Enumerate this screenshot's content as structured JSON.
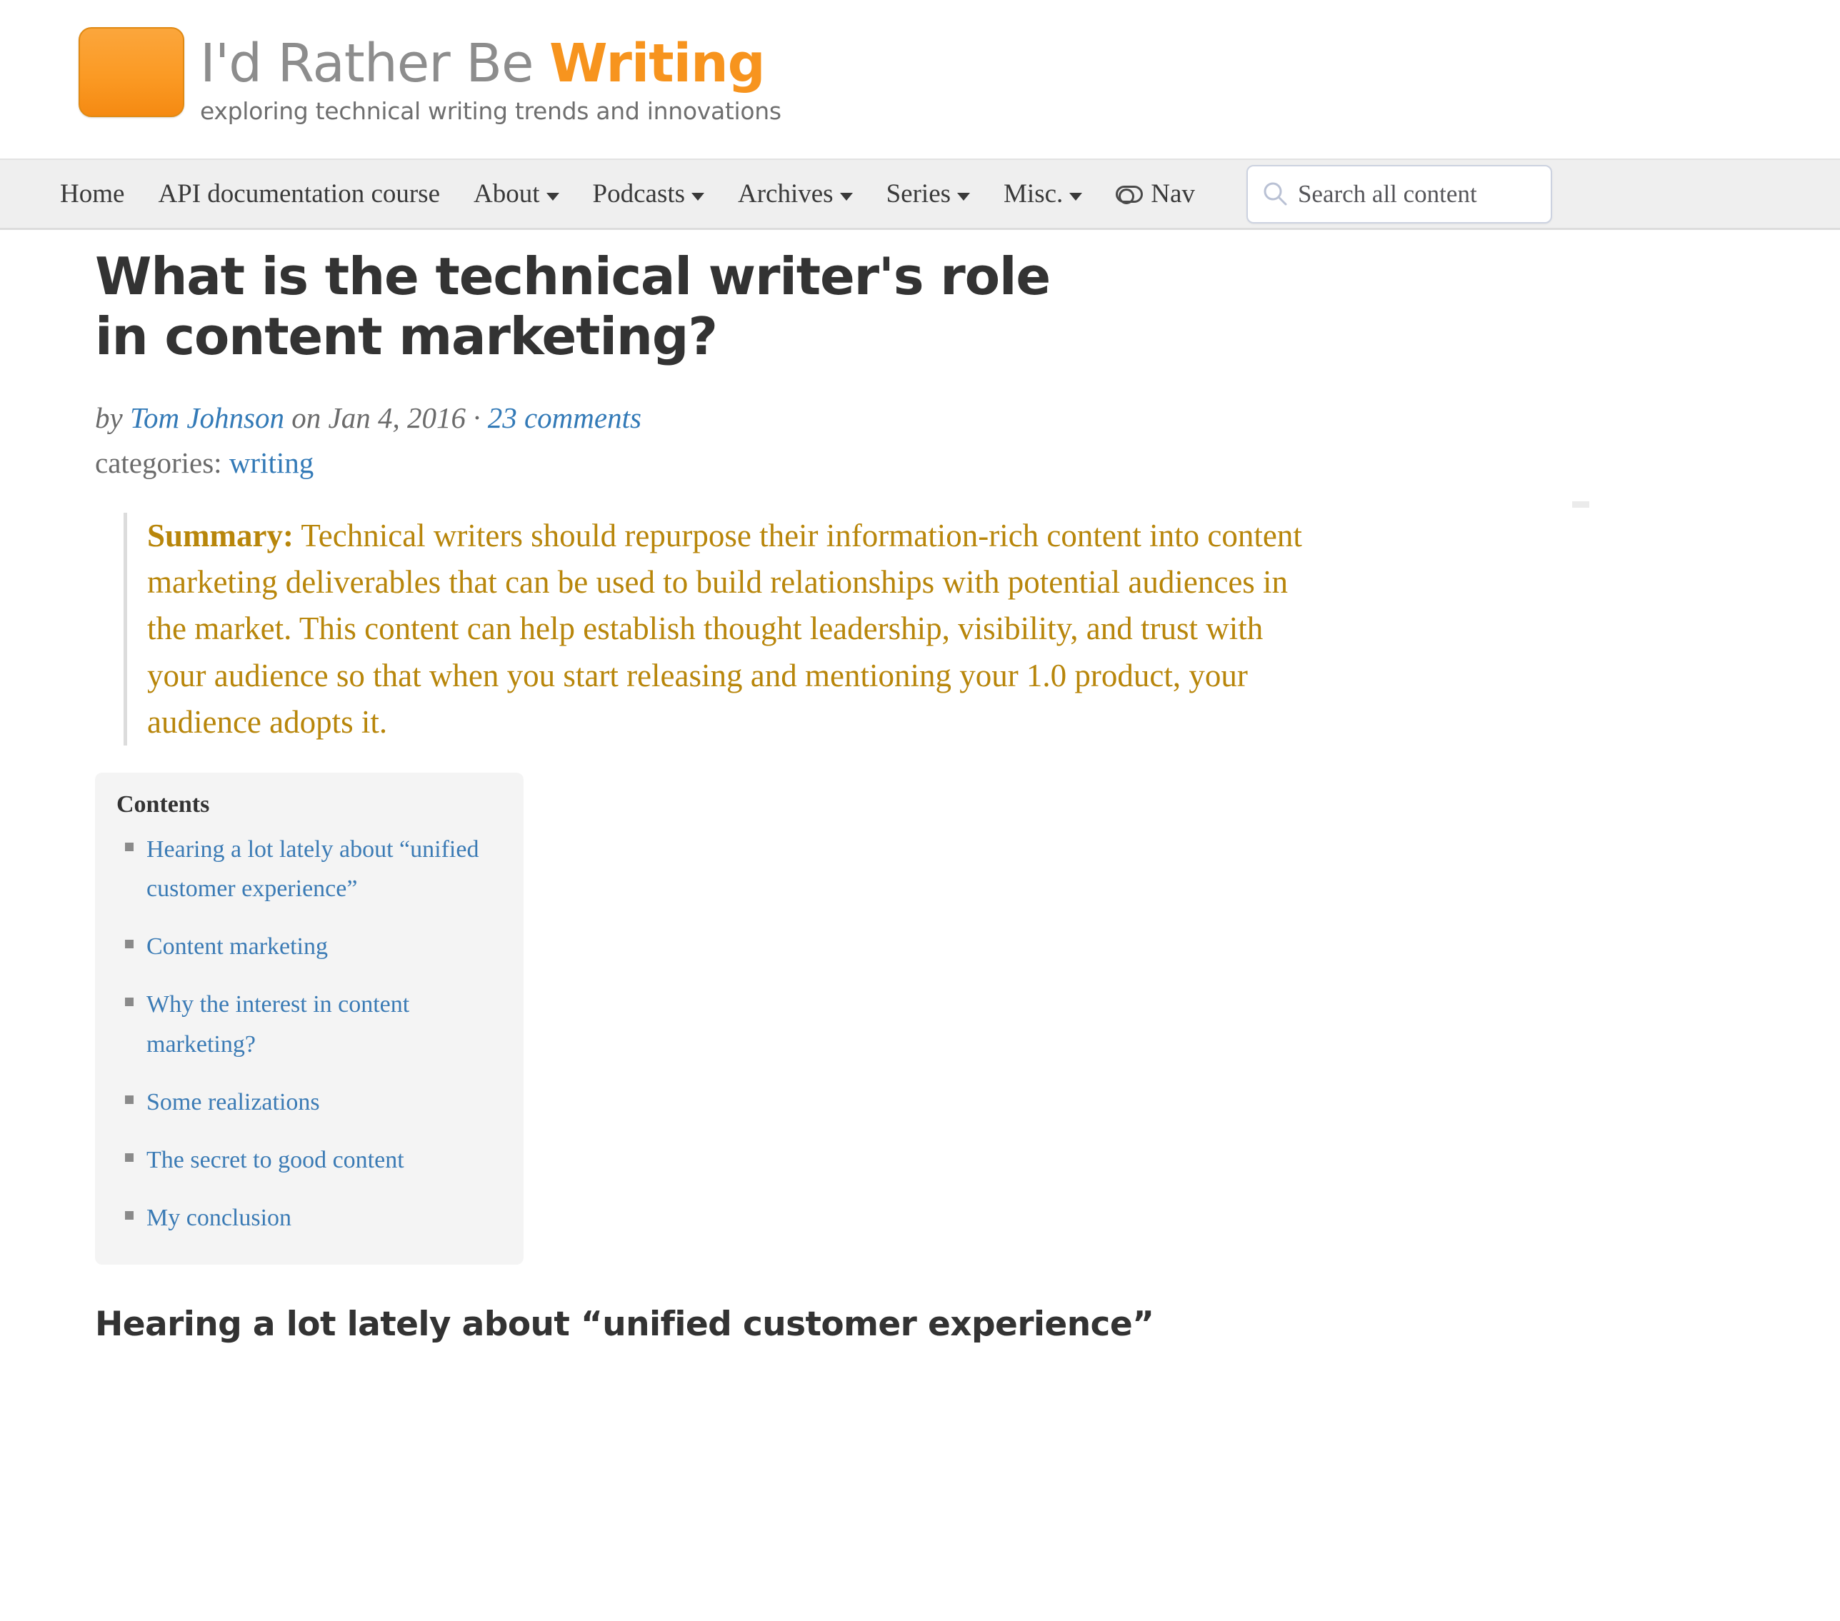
{
  "site": {
    "logo": {
      "mark_color": "#f7941e",
      "title_part1": "I'd Rather Be ",
      "title_part2": "Writing",
      "tagline": "exploring technical writing trends and innovations"
    }
  },
  "nav": {
    "items": [
      {
        "label": "Home",
        "has_caret": false
      },
      {
        "label": "API documentation course",
        "has_caret": false
      },
      {
        "label": "About",
        "has_caret": true
      },
      {
        "label": "Podcasts",
        "has_caret": true
      },
      {
        "label": "Archives",
        "has_caret": true
      },
      {
        "label": "Series",
        "has_caret": true
      },
      {
        "label": "Misc.",
        "has_caret": true
      }
    ],
    "nav_toggle_label": "Nav",
    "search": {
      "placeholder": "Search all content",
      "value": "",
      "icon": "search-icon"
    }
  },
  "post": {
    "title": "What is the technical writer's role in content marketing?",
    "byline": {
      "by_prefix": "by ",
      "author": "Tom Johnson",
      "on_text": " on Jan 4, 2016 · ",
      "comments": "23 comments"
    },
    "categories": {
      "label": "categories: ",
      "value": "writing"
    },
    "summary": {
      "label": "Summary:",
      "text": " Technical writers should repurpose their information-rich content into content marketing deliverables that can be used to build relationships with potential audiences in the market. This content can help establish thought leadership, visibility, and trust with your audience so that when you start releasing and mentioning your 1.0 product, your audience adopts it.",
      "color": "#b8860b"
    },
    "toc": {
      "heading": "Contents",
      "items": [
        "Hearing a lot lately about “unified customer experience”",
        "Content marketing",
        "Why the interest in content marketing?",
        "Some realizations",
        "The secret to good content",
        "My conclusion"
      ]
    },
    "first_section_heading": "Hearing a lot lately about “unified customer experience”"
  },
  "colors": {
    "link": "#337ab7",
    "toc_link": "#3b7bb5",
    "accent_orange": "#f7941e",
    "summary_gold": "#b8860b",
    "nav_bg": "#efefef",
    "toc_bg": "#f4f4f4"
  }
}
